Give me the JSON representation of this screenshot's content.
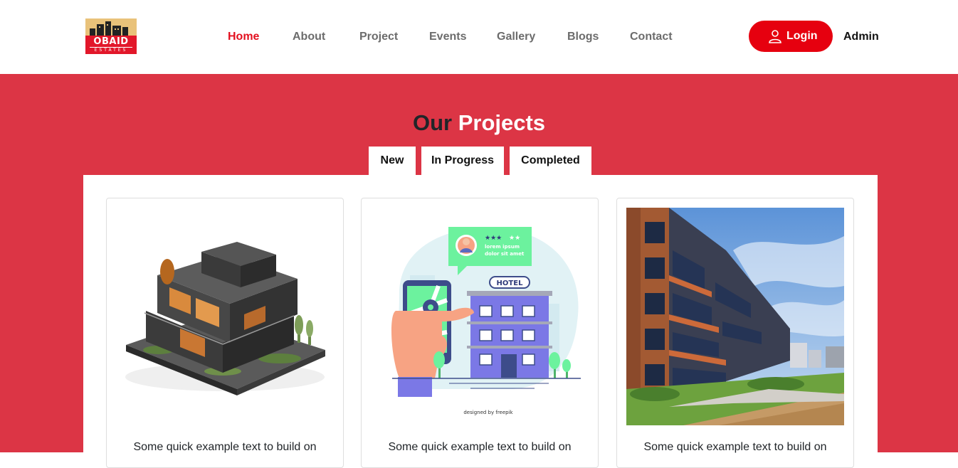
{
  "brand": {
    "name": "OBAID",
    "sub": "ESTATES"
  },
  "nav": {
    "items": [
      {
        "label": "Home",
        "active": true
      },
      {
        "label": "About"
      },
      {
        "label": "Project"
      },
      {
        "label": "Events"
      },
      {
        "label": "Gallery"
      },
      {
        "label": "Blogs"
      },
      {
        "label": "Contact"
      }
    ],
    "login_label": "Login",
    "admin_label": "Admin"
  },
  "section": {
    "title_part1": "Our",
    "title_part2": "Projects",
    "tabs": [
      "New",
      "In Progress",
      "Completed"
    ]
  },
  "cards": [
    {
      "image": "modern-house-illustration",
      "text": "Some quick example text to build on"
    },
    {
      "image": "hotel-map-app-illustration",
      "text": "Some quick example text to build on",
      "bubble": "lorem ipsum dolor sit amet",
      "sign": "HOTEL",
      "credit": "designed by freepik"
    },
    {
      "image": "apartment-building-photo",
      "text": "Some quick example text to build on"
    }
  ],
  "colors": {
    "accent": "#dc3545",
    "button": "#e6000f",
    "active_link": "#e3101f"
  }
}
